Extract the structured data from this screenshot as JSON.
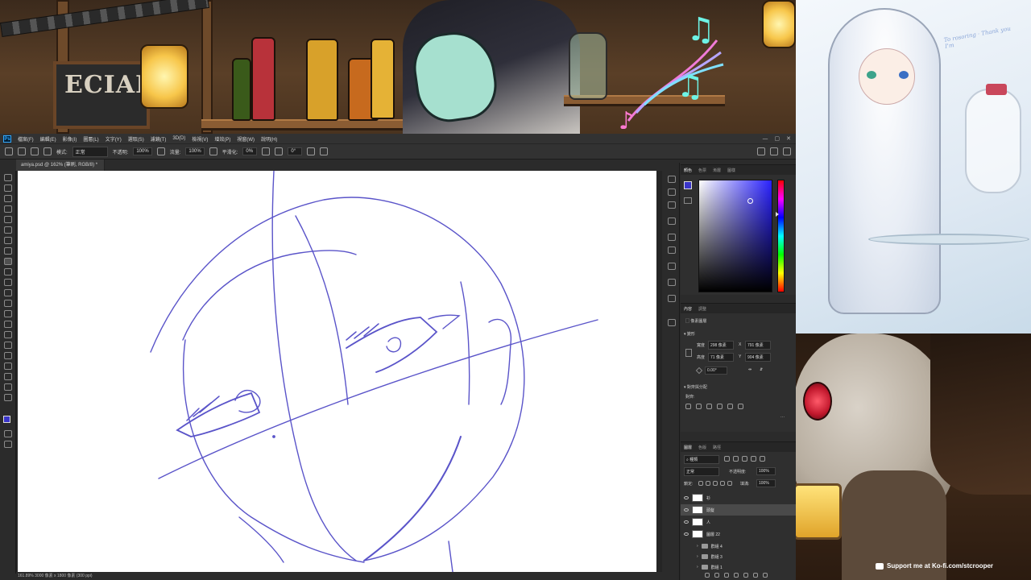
{
  "background": {
    "chalkboard_text": "ECIAL",
    "kofi_text": "Support me at Ko-fi.com/stcrooper",
    "art_top_note": "To rosoring · Thank you I'm"
  },
  "photoshop": {
    "logo": "Ps",
    "menu": [
      "檔案(F)",
      "編輯(E)",
      "影像(I)",
      "圖層(L)",
      "文字(Y)",
      "選取(S)",
      "濾鏡(T)",
      "3D(D)",
      "檢視(V)",
      "增效(P)",
      "視窗(W)",
      "說明(H)"
    ],
    "window_controls": [
      "—",
      "▢",
      "✕"
    ],
    "options": {
      "mode_label": "模式:",
      "mode_value": "正常",
      "opacity_label": "不透明:",
      "opacity_value": "100%",
      "flow_label": "流量:",
      "flow_value": "100%",
      "smoothing_label": "平滑化:",
      "smoothing_value": "0%",
      "angle_value": "0°"
    },
    "doc_tab": "amiya.psd @ 162% (筆刷, RGB/8) *",
    "status": "161.89%  3000 像素 x 1800 像素 (300 ppi)",
    "color_panel": {
      "tabs": [
        "顏色",
        "色票",
        "漸層",
        "圖樣"
      ],
      "fg_color": "#3a35c8",
      "bg_color": "#ffffff"
    },
    "properties_panel": {
      "tabs": [
        "內容",
        "調整"
      ],
      "type_label": "像素圖層",
      "section_transform": "變形",
      "w_label": "寬度",
      "w_value": "298 像素",
      "x_label": "X",
      "x_value": "791 像素",
      "h_label": "高度",
      "h_value": "71 像素",
      "y_label": "Y",
      "y_value": "904 像素",
      "rotation_value": "0.00°",
      "section_align": "對齊與分配",
      "align_label": "對齊:"
    },
    "layers_panel": {
      "tabs": [
        "圖層",
        "色版",
        "路徑"
      ],
      "kind_label": "種類",
      "blend_mode": "正常",
      "opacity_label": "不透明度:",
      "opacity_value": "100%",
      "lock_label": "鎖定:",
      "fill_label": "填滿:",
      "fill_value": "100%",
      "layers": [
        {
          "name": "衫",
          "kind": "pixel"
        },
        {
          "name": "頭髮",
          "kind": "pixel",
          "selected": true
        },
        {
          "name": "人",
          "kind": "pixel"
        },
        {
          "name": "圖層 22",
          "kind": "pixel"
        },
        {
          "name": "群組 4",
          "kind": "group"
        },
        {
          "name": "群組 3",
          "kind": "group"
        },
        {
          "name": "群組 1",
          "kind": "group"
        }
      ]
    }
  }
}
